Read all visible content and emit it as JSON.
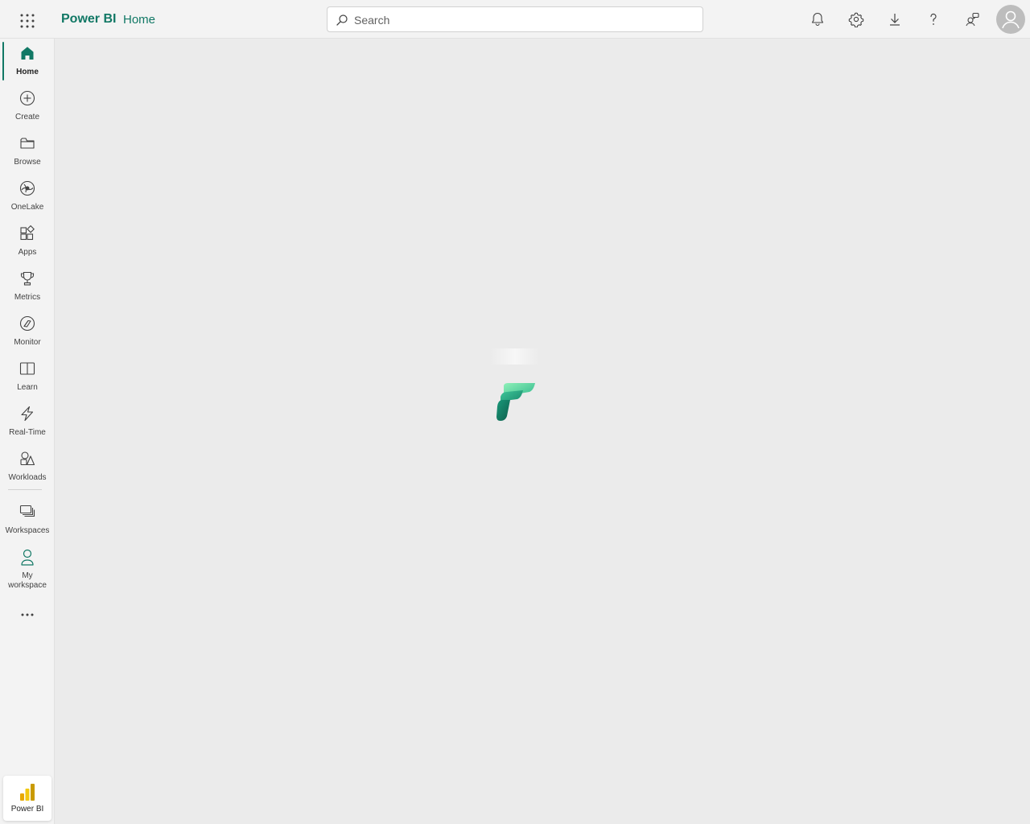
{
  "header": {
    "app_title": "Power BI",
    "breadcrumb": "Home",
    "search": {
      "placeholder": "Search",
      "value": ""
    },
    "icons": [
      "waffle-icon",
      "search-icon",
      "bell-icon",
      "gear-icon",
      "download-icon",
      "help-icon",
      "share-feedback-icon",
      "avatar-icon"
    ]
  },
  "sidebar": {
    "items": [
      {
        "label": "Home",
        "icon": "home-icon",
        "active": true
      },
      {
        "label": "Create",
        "icon": "plus-circle-icon"
      },
      {
        "label": "Browse",
        "icon": "folder-icon"
      },
      {
        "label": "OneLake",
        "icon": "onelake-icon"
      },
      {
        "label": "Apps",
        "icon": "apps-icon"
      },
      {
        "label": "Metrics",
        "icon": "trophy-icon"
      },
      {
        "label": "Monitor",
        "icon": "monitor-icon"
      },
      {
        "label": "Learn",
        "icon": "book-icon"
      },
      {
        "label": "Real-Time",
        "icon": "lightning-icon"
      },
      {
        "label": "Workloads",
        "icon": "shapes-icon"
      }
    ],
    "workspaces": {
      "label": "Workspaces",
      "icon": "workspaces-icon"
    },
    "my_workspace": {
      "label_line1": "My",
      "label_line2": "workspace",
      "icon": "person-icon"
    },
    "more": "...",
    "switcher": {
      "label": "Power BI",
      "icon": "powerbi-icon"
    }
  },
  "main": {
    "state": "loading",
    "loader_icon": "fabric-logo-icon"
  },
  "colors": {
    "accent": "#117865",
    "background": "#ebebeb",
    "chrome": "#f3f3f3",
    "powerbi_yellow": "#f2c811"
  }
}
